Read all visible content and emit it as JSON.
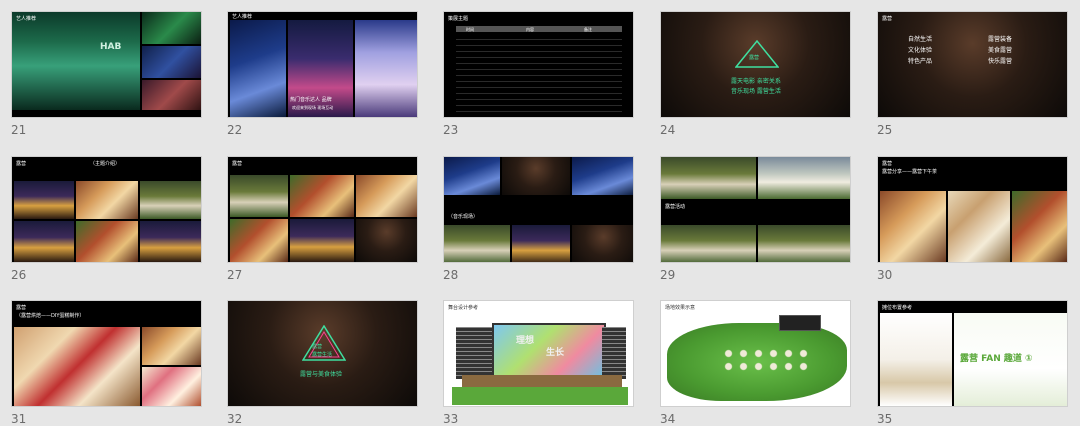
{
  "slides": [
    {
      "number": "21",
      "texts": [
        "艺人推荐",
        "HAB"
      ]
    },
    {
      "number": "22",
      "texts": [
        "艺人推荐",
        "热门音乐达人 品牌",
        "欢迎来到现场 现场互动"
      ]
    },
    {
      "number": "23",
      "texts": [
        "策展主题",
        "时间",
        "内容",
        "备注"
      ]
    },
    {
      "number": "24",
      "texts": [
        "露营",
        "露天电影 亲密关系",
        "音乐现场 露营生活"
      ]
    },
    {
      "number": "25",
      "texts": [
        "露营",
        "自然生活",
        "露营装备",
        "文化体验",
        "美食露营",
        "特色产品",
        "快乐露营"
      ]
    },
    {
      "number": "26",
      "texts": [
        "露营",
        "（主题介绍）"
      ]
    },
    {
      "number": "27",
      "texts": [
        "露营"
      ]
    },
    {
      "number": "28",
      "texts": [
        "（音乐现场）"
      ]
    },
    {
      "number": "29",
      "texts": [
        "露营活动"
      ]
    },
    {
      "number": "30",
      "texts": [
        "露营",
        "露营分享——露营下午茶"
      ]
    },
    {
      "number": "31",
      "texts": [
        "露营",
        "（露营烘焙——DIY蛋糕制作）"
      ]
    },
    {
      "number": "32",
      "texts": [
        "露营",
        "露营生活",
        "露营与美食体验"
      ]
    },
    {
      "number": "33",
      "texts": [
        "舞台设计参考",
        "理想",
        "生长"
      ]
    },
    {
      "number": "34",
      "texts": [
        "场地效果示意"
      ]
    },
    {
      "number": "35",
      "texts": [
        "摊位布置参考",
        "露营 FAN 趣道 ①"
      ]
    }
  ],
  "colors": {
    "background": "#e6e6e6",
    "slide_dark": "#000000",
    "number_text": "#6b6b6b",
    "neon_green": "#3fe0a0",
    "neon_pink": "#ff3f8f",
    "grass": "#5aa83a"
  }
}
